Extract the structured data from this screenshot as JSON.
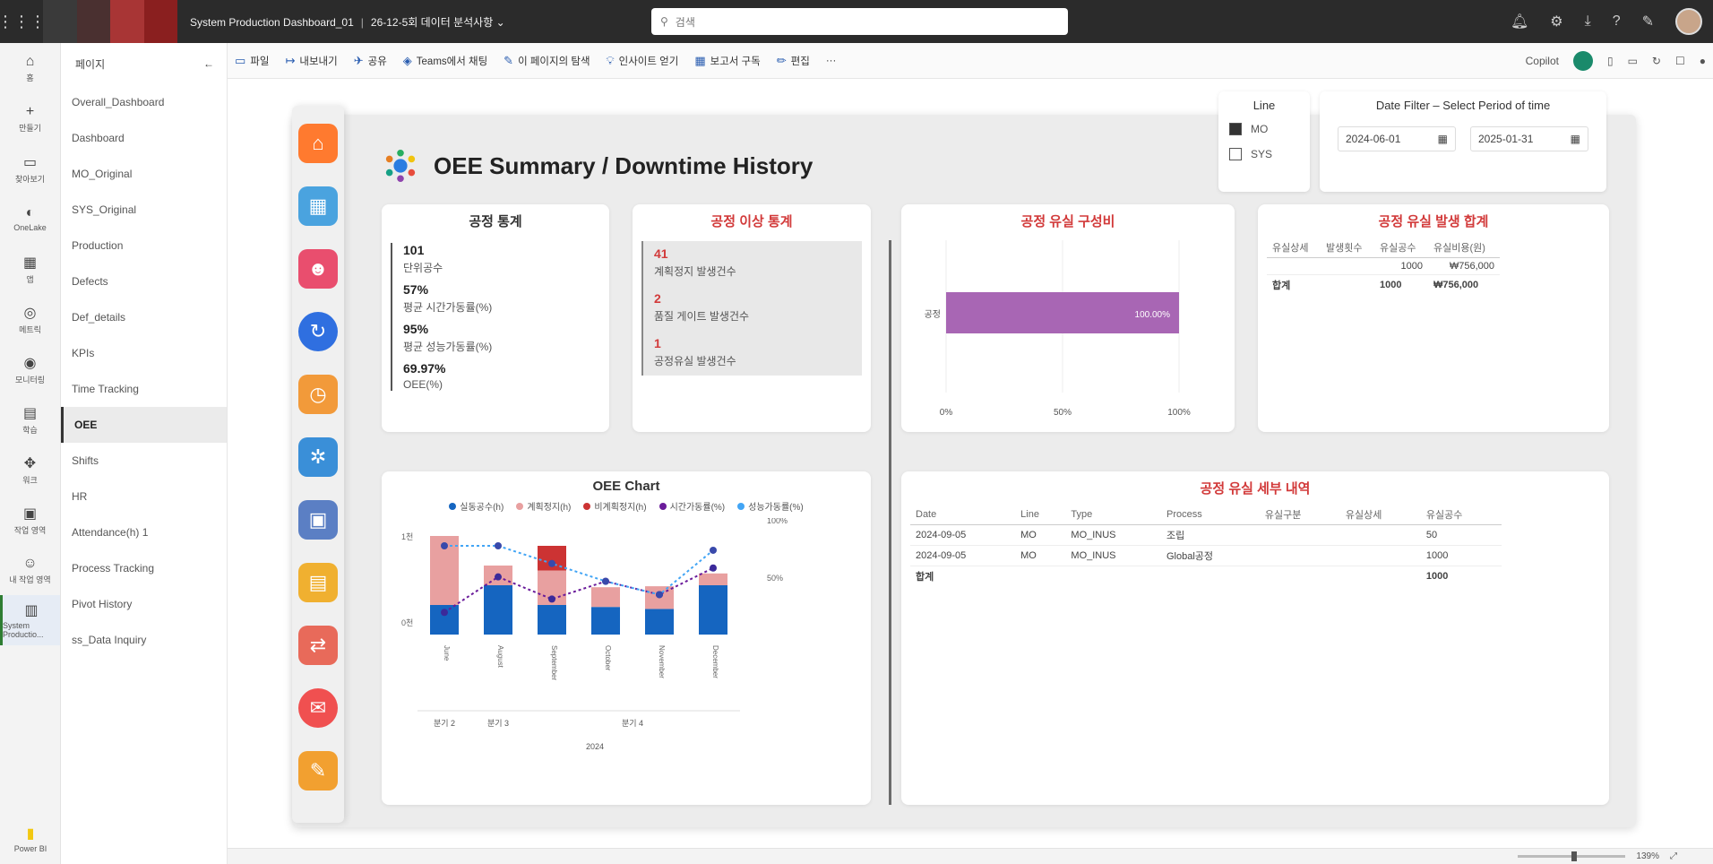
{
  "topbar": {
    "app_title": "System Production Dashboard_01",
    "file_title": "26-12-5회 데이터 분석사항",
    "search_placeholder": "검색",
    "brand_colors": [
      "#3a3a3a",
      "#5a2a2a",
      "#b23a3a",
      "#8a1f1f"
    ]
  },
  "rail": [
    {
      "label": "홈",
      "icon": "home-icon"
    },
    {
      "label": "만들기",
      "icon": "plus-icon"
    },
    {
      "label": "찾아보기",
      "icon": "folder-icon"
    },
    {
      "label": "OneLake",
      "icon": "onelake-icon"
    },
    {
      "label": "앱",
      "icon": "apps-icon"
    },
    {
      "label": "메트릭",
      "icon": "metrics-icon"
    },
    {
      "label": "모니터링",
      "icon": "monitor-icon"
    },
    {
      "label": "학습",
      "icon": "learn-icon"
    },
    {
      "label": "워크",
      "icon": "workspace-icon"
    },
    {
      "label": "작업 영역",
      "icon": "workspaces-icon"
    },
    {
      "label": "내 작업 영역",
      "icon": "user-icon"
    },
    {
      "label": "System Productio...",
      "icon": "report-icon"
    }
  ],
  "rail_bottom": {
    "label": "Power BI"
  },
  "pages": {
    "header": "페이지",
    "items": [
      "Overall_Dashboard",
      "Dashboard",
      "MO_Original",
      "SYS_Original",
      "Production",
      "Defects",
      "Def_details",
      "KPIs",
      "Time Tracking",
      "OEE",
      "Shifts",
      "HR",
      "Attendance(h) 1",
      "Process Tracking",
      "Pivot History",
      "ss_Data Inquiry"
    ],
    "active_index": 9
  },
  "toolbar": {
    "items": [
      "파일",
      "내보내기",
      "공유",
      "Teams에서 채팅",
      "이 페이지의 탐색",
      "인사이트 얻기",
      "보고서 구독",
      "편집"
    ],
    "copilot": "Copilot"
  },
  "report": {
    "title": "OEE Summary / Downtime History",
    "line_filter": {
      "title": "Line",
      "options": [
        {
          "label": "MO",
          "checked": true
        },
        {
          "label": "SYS",
          "checked": false
        }
      ]
    },
    "date_filter": {
      "title": "Date Filter – Select Period of time",
      "start": "2024-06-01",
      "end": "2025-01-31"
    },
    "stats_card": {
      "title": "공정 통계",
      "items": [
        {
          "value": "101",
          "label": "단위공수"
        },
        {
          "value": "57%",
          "label": "평균 시간가동률(%)"
        },
        {
          "value": "95%",
          "label": "평균 성능가동률(%)"
        },
        {
          "value": "69.97%",
          "label": "OEE(%)"
        }
      ]
    },
    "anomaly_card": {
      "title": "공정 이상 통계",
      "items": [
        {
          "value": "41",
          "label": "계획정지 발생건수"
        },
        {
          "value": "2",
          "label": "품질 게이트 발생건수"
        },
        {
          "value": "1",
          "label": "공정유실 발생건수"
        }
      ]
    },
    "loss_chart": {
      "title": "공정 유실 구성비",
      "bar_label": "공정",
      "value_label": "100.00%",
      "axis": [
        "0%",
        "50%",
        "100%"
      ],
      "bar_color": "#a866b4"
    },
    "loss_summary": {
      "title": "공정 유실 발생 합계",
      "headers": [
        "유실상세",
        "발생횟수",
        "유실공수",
        "유실비용(원)"
      ],
      "rows": [
        [
          "",
          "",
          "1000",
          "₩756,000"
        ]
      ],
      "total": [
        "합계",
        "",
        "1000",
        "₩756,000"
      ]
    },
    "loss_detail": {
      "title": "공정 유실 세부 내역",
      "headers": [
        "Date",
        "Line",
        "Type",
        "Process",
        "유실구분",
        "유실상세",
        "유실공수"
      ],
      "rows": [
        [
          "2024-09-05",
          "MO",
          "MO_INUS",
          "조립",
          "",
          "",
          "50"
        ],
        [
          "2024-09-05",
          "MO",
          "MO_INUS",
          "Global공정",
          "",
          "",
          "1000"
        ]
      ],
      "total": [
        "합계",
        "",
        "",
        "",
        "",
        "",
        "1000"
      ]
    },
    "oee_chart": {
      "title": "OEE Chart",
      "legend": [
        {
          "name": "실동공수(h)",
          "color": "#1565c0"
        },
        {
          "name": "계획정지(h)",
          "color": "#e8a0a0"
        },
        {
          "name": "비계획정지(h)",
          "color": "#cc3333"
        },
        {
          "name": "시간가동률(%)",
          "color": "#6a1b9a"
        },
        {
          "name": "성능가동률(%)",
          "color": "#42a5f5"
        }
      ],
      "y_left": [
        "1천",
        "0천"
      ],
      "y_right": [
        "100%",
        "50%"
      ],
      "categories": [
        "June",
        "August",
        "September",
        "October",
        "November",
        "December"
      ],
      "quarters": [
        "분기 2",
        "분기 3",
        "분기 4"
      ],
      "year": "2024"
    }
  },
  "chart_data": {
    "type": "bar",
    "title": "OEE Chart",
    "categories": [
      "June",
      "August",
      "September",
      "October",
      "November",
      "December"
    ],
    "series": [
      {
        "name": "실동공수(h)",
        "values": [
          300,
          500,
          300,
          280,
          260,
          500
        ]
      },
      {
        "name": "계획정지(h)",
        "values": [
          700,
          200,
          350,
          200,
          230,
          120
        ]
      },
      {
        "name": "비계획정지(h)",
        "values": [
          0,
          0,
          250,
          0,
          0,
          0
        ]
      },
      {
        "name": "시간가동률(%)",
        "values": [
          25,
          65,
          40,
          60,
          45,
          75
        ]
      },
      {
        "name": "성능가동률(%)",
        "values": [
          100,
          100,
          80,
          60,
          45,
          95
        ]
      }
    ],
    "ylim": [
      0,
      1000
    ],
    "y2lim": [
      0,
      100
    ],
    "legend_position": "top"
  },
  "statusbar": {
    "zoom": "139%"
  }
}
